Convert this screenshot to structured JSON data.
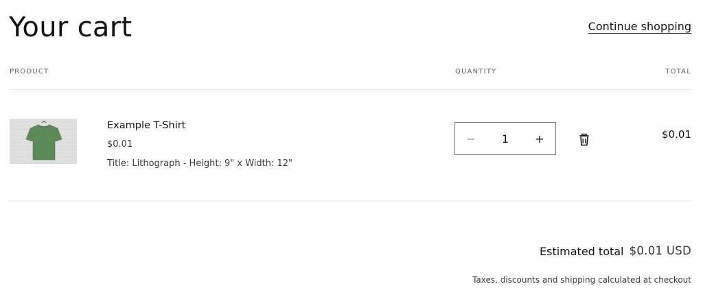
{
  "header": {
    "title": "Your cart",
    "continue_link": "Continue shopping"
  },
  "columns": {
    "product": "PRODUCT",
    "quantity": "QUANTITY",
    "total": "TOTAL"
  },
  "items": [
    {
      "name": "Example T-Shirt",
      "price": "$0.01",
      "option": "Title: Lithograph - Height: 9\" x Width: 12\"",
      "quantity": "1",
      "line_total": "$0.01",
      "image_icon": "t-shirt-image",
      "shirt_color": "#5d8a58"
    }
  ],
  "quantity_controls": {
    "decrease_symbol": "−",
    "increase_symbol": "+",
    "remove_icon": "trash-icon"
  },
  "summary": {
    "estimated_label": "Estimated total",
    "estimated_value": "$0.01 USD",
    "tax_note": "Taxes, discounts and shipping calculated at checkout"
  }
}
